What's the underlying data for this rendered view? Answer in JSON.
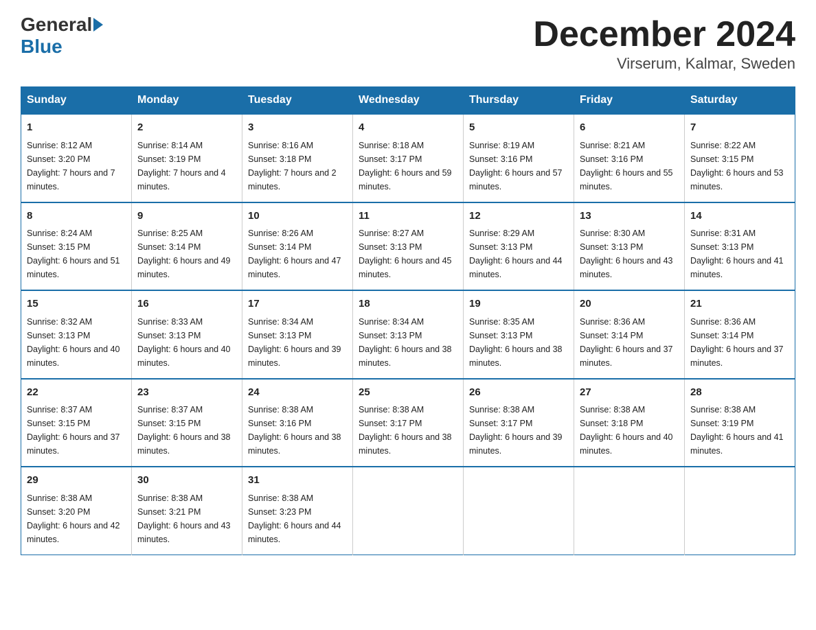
{
  "logo": {
    "text_general": "General",
    "text_blue": "Blue"
  },
  "header": {
    "month": "December 2024",
    "location": "Virserum, Kalmar, Sweden"
  },
  "days_of_week": [
    "Sunday",
    "Monday",
    "Tuesday",
    "Wednesday",
    "Thursday",
    "Friday",
    "Saturday"
  ],
  "weeks": [
    [
      {
        "day": "1",
        "sunrise": "8:12 AM",
        "sunset": "3:20 PM",
        "daylight": "7 hours and 7 minutes."
      },
      {
        "day": "2",
        "sunrise": "8:14 AM",
        "sunset": "3:19 PM",
        "daylight": "7 hours and 4 minutes."
      },
      {
        "day": "3",
        "sunrise": "8:16 AM",
        "sunset": "3:18 PM",
        "daylight": "7 hours and 2 minutes."
      },
      {
        "day": "4",
        "sunrise": "8:18 AM",
        "sunset": "3:17 PM",
        "daylight": "6 hours and 59 minutes."
      },
      {
        "day": "5",
        "sunrise": "8:19 AM",
        "sunset": "3:16 PM",
        "daylight": "6 hours and 57 minutes."
      },
      {
        "day": "6",
        "sunrise": "8:21 AM",
        "sunset": "3:16 PM",
        "daylight": "6 hours and 55 minutes."
      },
      {
        "day": "7",
        "sunrise": "8:22 AM",
        "sunset": "3:15 PM",
        "daylight": "6 hours and 53 minutes."
      }
    ],
    [
      {
        "day": "8",
        "sunrise": "8:24 AM",
        "sunset": "3:15 PM",
        "daylight": "6 hours and 51 minutes."
      },
      {
        "day": "9",
        "sunrise": "8:25 AM",
        "sunset": "3:14 PM",
        "daylight": "6 hours and 49 minutes."
      },
      {
        "day": "10",
        "sunrise": "8:26 AM",
        "sunset": "3:14 PM",
        "daylight": "6 hours and 47 minutes."
      },
      {
        "day": "11",
        "sunrise": "8:27 AM",
        "sunset": "3:13 PM",
        "daylight": "6 hours and 45 minutes."
      },
      {
        "day": "12",
        "sunrise": "8:29 AM",
        "sunset": "3:13 PM",
        "daylight": "6 hours and 44 minutes."
      },
      {
        "day": "13",
        "sunrise": "8:30 AM",
        "sunset": "3:13 PM",
        "daylight": "6 hours and 43 minutes."
      },
      {
        "day": "14",
        "sunrise": "8:31 AM",
        "sunset": "3:13 PM",
        "daylight": "6 hours and 41 minutes."
      }
    ],
    [
      {
        "day": "15",
        "sunrise": "8:32 AM",
        "sunset": "3:13 PM",
        "daylight": "6 hours and 40 minutes."
      },
      {
        "day": "16",
        "sunrise": "8:33 AM",
        "sunset": "3:13 PM",
        "daylight": "6 hours and 40 minutes."
      },
      {
        "day": "17",
        "sunrise": "8:34 AM",
        "sunset": "3:13 PM",
        "daylight": "6 hours and 39 minutes."
      },
      {
        "day": "18",
        "sunrise": "8:34 AM",
        "sunset": "3:13 PM",
        "daylight": "6 hours and 38 minutes."
      },
      {
        "day": "19",
        "sunrise": "8:35 AM",
        "sunset": "3:13 PM",
        "daylight": "6 hours and 38 minutes."
      },
      {
        "day": "20",
        "sunrise": "8:36 AM",
        "sunset": "3:14 PM",
        "daylight": "6 hours and 37 minutes."
      },
      {
        "day": "21",
        "sunrise": "8:36 AM",
        "sunset": "3:14 PM",
        "daylight": "6 hours and 37 minutes."
      }
    ],
    [
      {
        "day": "22",
        "sunrise": "8:37 AM",
        "sunset": "3:15 PM",
        "daylight": "6 hours and 37 minutes."
      },
      {
        "day": "23",
        "sunrise": "8:37 AM",
        "sunset": "3:15 PM",
        "daylight": "6 hours and 38 minutes."
      },
      {
        "day": "24",
        "sunrise": "8:38 AM",
        "sunset": "3:16 PM",
        "daylight": "6 hours and 38 minutes."
      },
      {
        "day": "25",
        "sunrise": "8:38 AM",
        "sunset": "3:17 PM",
        "daylight": "6 hours and 38 minutes."
      },
      {
        "day": "26",
        "sunrise": "8:38 AM",
        "sunset": "3:17 PM",
        "daylight": "6 hours and 39 minutes."
      },
      {
        "day": "27",
        "sunrise": "8:38 AM",
        "sunset": "3:18 PM",
        "daylight": "6 hours and 40 minutes."
      },
      {
        "day": "28",
        "sunrise": "8:38 AM",
        "sunset": "3:19 PM",
        "daylight": "6 hours and 41 minutes."
      }
    ],
    [
      {
        "day": "29",
        "sunrise": "8:38 AM",
        "sunset": "3:20 PM",
        "daylight": "6 hours and 42 minutes."
      },
      {
        "day": "30",
        "sunrise": "8:38 AM",
        "sunset": "3:21 PM",
        "daylight": "6 hours and 43 minutes."
      },
      {
        "day": "31",
        "sunrise": "8:38 AM",
        "sunset": "3:23 PM",
        "daylight": "6 hours and 44 minutes."
      },
      null,
      null,
      null,
      null
    ]
  ]
}
